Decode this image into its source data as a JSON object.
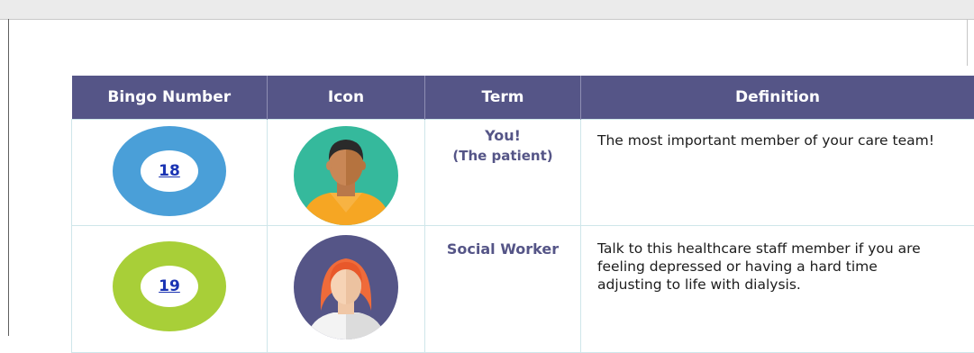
{
  "table": {
    "headers": [
      "Bingo Number",
      "Icon",
      "Term",
      "Definition"
    ],
    "rows": [
      {
        "number": "18",
        "ring_color": "#4a9fd8",
        "icon": "patient-avatar-icon",
        "term": "You!",
        "term_sub": "(The patient)",
        "definition": "The most important member of your care team!"
      },
      {
        "number": "19",
        "ring_color": "#a8cf38",
        "icon": "social-worker-avatar-icon",
        "term": "Social Worker",
        "term_sub": "",
        "definition": "Talk to this healthcare staff member if you are feeling depressed or having a hard time adjusting to life with dialysis."
      }
    ]
  },
  "colors": {
    "header_bg": "#555587",
    "term_text": "#555587",
    "link": "#1a33b3"
  }
}
